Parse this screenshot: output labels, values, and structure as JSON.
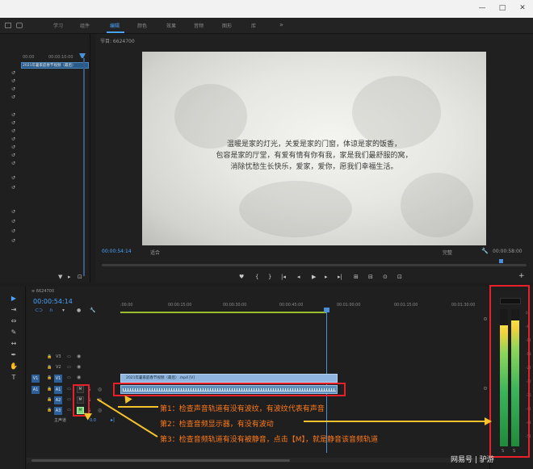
{
  "window": {
    "min_label": "—",
    "max_label": "□",
    "close_label": "✕"
  },
  "workspace": {
    "tabs": [
      {
        "label": "学习"
      },
      {
        "label": "组件"
      },
      {
        "label": "编辑"
      },
      {
        "label": "颜色"
      },
      {
        "label": "效果"
      },
      {
        "label": "音频"
      },
      {
        "label": "图形"
      },
      {
        "label": "库"
      }
    ],
    "more_label": "»"
  },
  "source": {
    "timecode_start": "00:00",
    "timecode_end": "00:00:10:00",
    "clip_label": "2021年暑家庭春节视频（最后）"
  },
  "monitor": {
    "title": "节目: 6624700",
    "quote_lines": [
      "温暖是家的灯光，关爱是家的门窗，体谅是家的饭香，",
      "包容是家的厅堂，有爱有情有你有我，家是我们最舒服的窝，",
      "消除忧愁生长快乐，爱家，爱你，愿我们幸福生活。"
    ],
    "timecode_current": "00:00:54:14",
    "fit_label": "适合",
    "quality_label": "完整",
    "timecode_duration": "00:00:58:00",
    "controls": [
      "♥",
      "{",
      "}",
      "|◂",
      "◂|",
      "◂",
      "▶",
      "▸",
      "▸|",
      "⊞",
      "⊟",
      "⊙",
      "⊡",
      "+"
    ]
  },
  "timeline": {
    "sequence_tab": "≡ 6624700",
    "timecode": "00:00:54:14",
    "ruler": [
      ":00:00",
      "00:00:15:00",
      "00:00:30:00",
      "00:00:45:00",
      "00:01:00:00",
      "00:01:15:00",
      "00:01:30:00"
    ],
    "tracks": {
      "v3": "V3",
      "v2": "V2",
      "v1": "V1",
      "a1": "A1",
      "a2": "A2",
      "a3": "A3",
      "master": "主声道",
      "master_value": "0.0"
    },
    "v1_clip_label": "2021年暑家庭春节视频（最后）.mp4 [V]",
    "track_m": "M",
    "track_s": "S"
  },
  "meters": {
    "left_level_pct": 0.88,
    "right_level_pct": 0.92,
    "ticks": [
      "0",
      "-6",
      "-12",
      "-18",
      "-24",
      "-30",
      "-36",
      "-42",
      "-48",
      "-54"
    ],
    "solo_labels": [
      "S",
      "S"
    ]
  },
  "annotations": {
    "step1": "第1：检查声音轨道有没有波纹，有波纹代表有声音",
    "step2": "第2：检查音频显示器，有没有波动",
    "step3": "第3：检查音频轨道有没有被静音，点击【M】，就是静音该音频轨道"
  },
  "watermark": "网易号 | 驴游"
}
